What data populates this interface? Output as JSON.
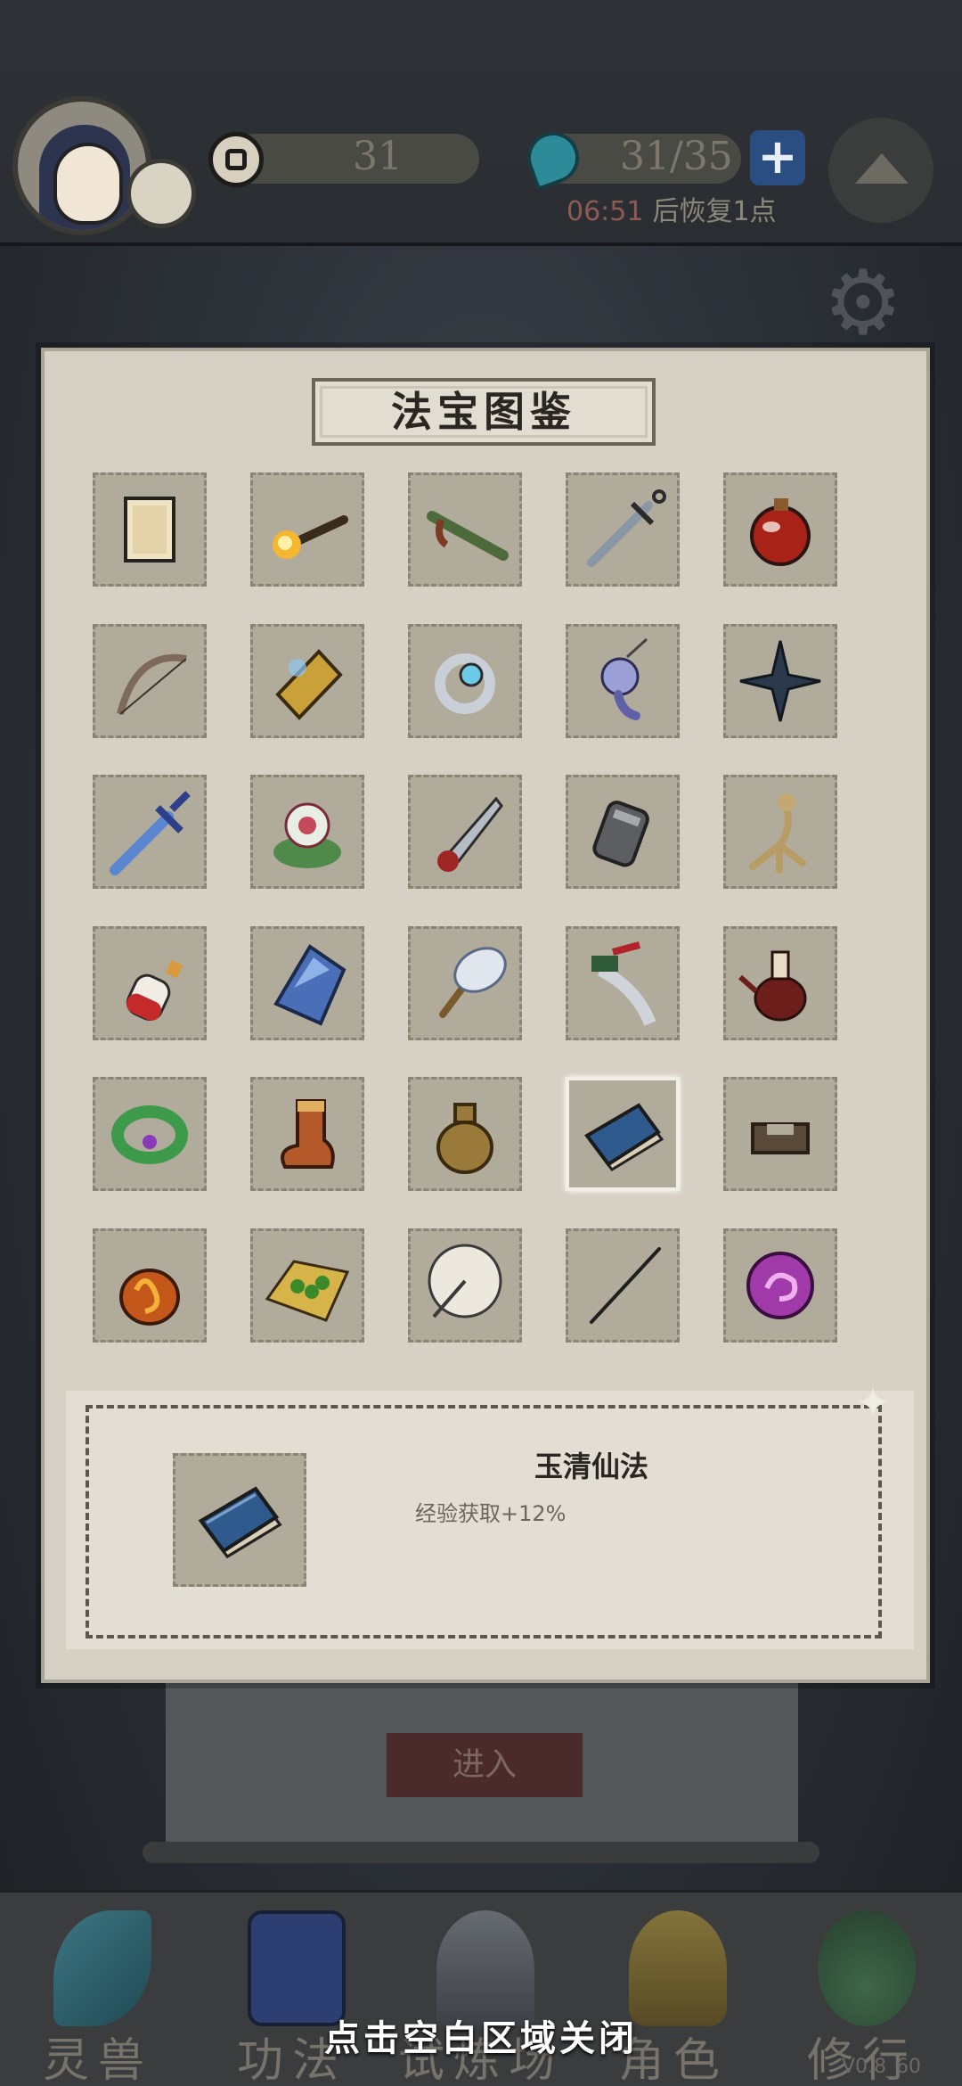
{
  "top_bar": {
    "coins": "31",
    "stamina": "31/35",
    "recovery_timer": "06:51",
    "recovery_text": "后恢复1点"
  },
  "modal": {
    "title": "法宝图鉴",
    "items": [
      {
        "icon": "scroll-paper-icon"
      },
      {
        "icon": "torch-icon"
      },
      {
        "icon": "flute-icon"
      },
      {
        "icon": "sword-icon"
      },
      {
        "icon": "red-gourd-icon"
      },
      {
        "icon": "bow-icon"
      },
      {
        "icon": "talisman-icon"
      },
      {
        "icon": "ring-icon"
      },
      {
        "icon": "jade-pendant-icon"
      },
      {
        "icon": "shuriken-icon"
      },
      {
        "icon": "blue-sword-icon"
      },
      {
        "icon": "lotus-icon"
      },
      {
        "icon": "dagger-icon"
      },
      {
        "icon": "bracer-icon"
      },
      {
        "icon": "ginseng-icon"
      },
      {
        "icon": "potion-bottle-icon"
      },
      {
        "icon": "crystal-icon"
      },
      {
        "icon": "feather-fan-icon"
      },
      {
        "icon": "curved-knife-icon"
      },
      {
        "icon": "teapot-icon"
      },
      {
        "icon": "jade-bracelet-icon"
      },
      {
        "icon": "boot-icon"
      },
      {
        "icon": "money-pouch-icon"
      },
      {
        "icon": "blue-book-icon"
      },
      {
        "icon": "stone-seal-icon"
      },
      {
        "icon": "fire-bag-icon"
      },
      {
        "icon": "herb-mat-icon"
      },
      {
        "icon": "umbrella-icon"
      },
      {
        "icon": "needle-icon"
      },
      {
        "icon": "purple-orb-icon"
      }
    ],
    "selected_index": 23,
    "detail": {
      "name": "玉清仙法",
      "description": "经验获取+12%"
    }
  },
  "background": {
    "enter_label": "进入"
  },
  "bottom_nav": {
    "items": [
      {
        "label": "灵兽"
      },
      {
        "label": "功法"
      },
      {
        "label": "试炼场"
      },
      {
        "label": "角色"
      },
      {
        "label": "修行"
      }
    ]
  },
  "hint": "点击空白区域关闭",
  "version": "V0.8_60"
}
